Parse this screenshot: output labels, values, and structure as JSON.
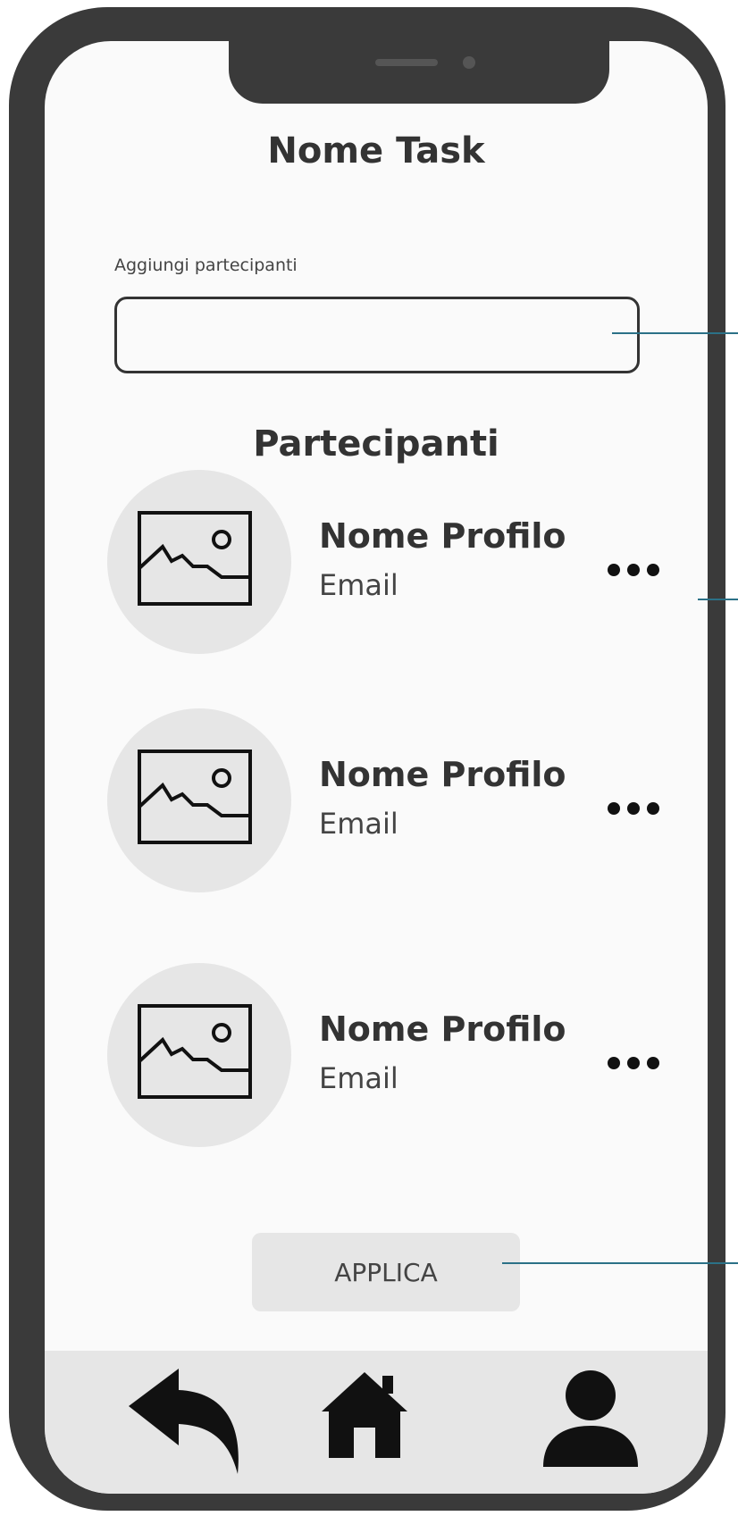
{
  "screen": {
    "title": "Nome Task",
    "participants_input": {
      "label": "Aggiungi partecipanti",
      "value": "",
      "placeholder": ""
    },
    "section_title": "Partecipanti",
    "participants": [
      {
        "name": "Nome Profilo",
        "email": "Email"
      },
      {
        "name": "Nome Profilo",
        "email": "Email"
      },
      {
        "name": "Nome Profilo",
        "email": "Email"
      }
    ],
    "apply_label": "APPLICA"
  },
  "bottom_nav": {
    "items": [
      {
        "icon": "back-arrow-icon"
      },
      {
        "icon": "home-icon"
      },
      {
        "icon": "user-icon"
      }
    ]
  },
  "colors": {
    "phone_frame": "#3a3a3a",
    "screen_background": "#fafafa",
    "avatar_background": "#e6e6e6",
    "button_background": "#e6e6e6",
    "annotation_line": "#2b7187"
  }
}
